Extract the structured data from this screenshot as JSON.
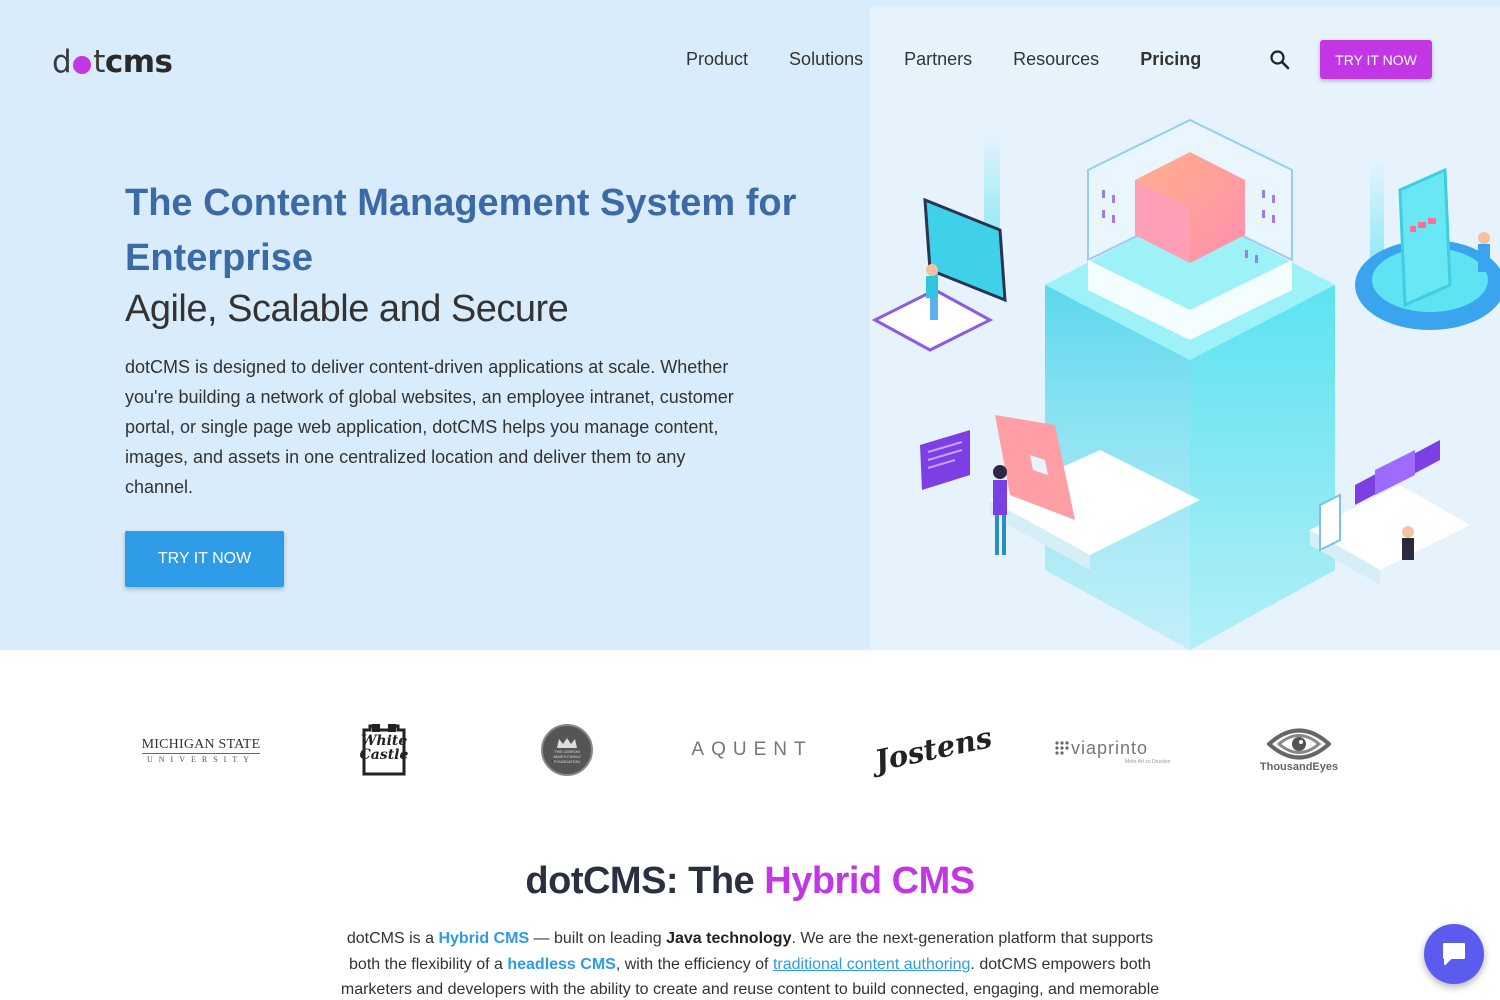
{
  "brand": {
    "logo_prefix": "d",
    "logo_mid": "t",
    "logo_suffix": "cms",
    "accent": "#c336e5",
    "link_blue": "#2e9be6",
    "heading_blue": "#3b6aa6"
  },
  "nav": {
    "items": [
      {
        "label": "Product"
      },
      {
        "label": "Solutions"
      },
      {
        "label": "Partners"
      },
      {
        "label": "Resources"
      },
      {
        "label": "Pricing"
      }
    ],
    "search_icon": "search-icon",
    "cta": "TRY IT NOW"
  },
  "hero": {
    "title": "The Content Management System for Enterprise",
    "subtitle": "Agile, Scalable and Secure",
    "body": "dotCMS is designed to deliver content-driven applications at scale. Whether you're building a network of global websites, an employee intranet, customer portal, or single page web application, dotCMS helps you manage content, images, and assets in one centralized location and deliver them to any channel.",
    "cta": "TRY IT NOW"
  },
  "clients": {
    "msu_line1": "MICHIGAN STATE",
    "msu_line2": "UNIVERSITY",
    "white_castle_1": "White",
    "white_castle_2": "Castle",
    "lebron_1": "THE LEBRON",
    "lebron_2": "JAMES FAMILY",
    "lebron_3": "FOUNDATION",
    "aquent": "AQUENT",
    "jostens": "Jostens",
    "viaprinto": "viaprinto",
    "viaprinto_tag": "Mehr Art zu Drucken",
    "thousandeyes": "ThousandEyes"
  },
  "hybrid": {
    "title_prefix": "dotCMS: The ",
    "title_accent": "Hybrid CMS",
    "p_1": "dotCMS is a ",
    "p_link1": "Hybrid CMS",
    "p_2": " — built on leading ",
    "p_bold1": "Java technology",
    "p_3": ". We are the next-generation platform that supports both the flexibility of a ",
    "p_link2": "headless CMS",
    "p_4": ", with the efficiency of ",
    "p_link3": "traditional content authoring",
    "p_5": ". dotCMS empowers both marketers and developers with the ability to create and reuse content to build connected, engaging, and memorable"
  },
  "chat": {
    "icon": "chat-bubble-icon"
  }
}
